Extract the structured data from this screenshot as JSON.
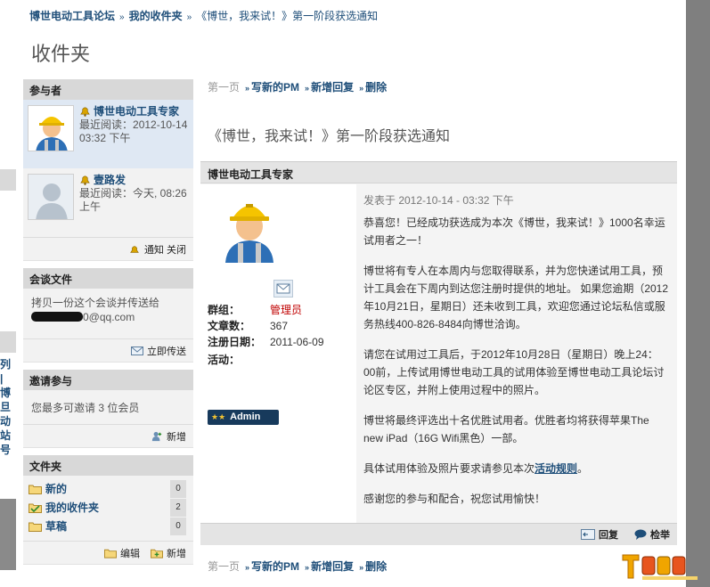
{
  "breadcrumb": {
    "forum": "博世电动工具论坛",
    "inbox": "我的收件夹",
    "current": "《博世，我来试！》第一阶段获选通知",
    "sep": "»"
  },
  "page_title": "收件夹",
  "sidebar": {
    "participants": {
      "header": "参与者",
      "items": [
        {
          "name": "博世电动工具专家",
          "last_read_label": "最近阅读：",
          "last_read": "2012-10-14 03:32 下午"
        },
        {
          "name": "壹路发",
          "last_read_label": "最近阅读：",
          "last_read": "今天, 08:26 上午"
        }
      ],
      "footer_action": "通知 关闭"
    },
    "conversation": {
      "header": "会谈文件",
      "text": "拷贝一份这个会谈并传送给",
      "email_suffix": "0@qq.com",
      "footer_action": "立即传送"
    },
    "invite": {
      "header": "邀请参与",
      "text": "您最多可邀请 3 位会员",
      "footer_action": "新增"
    },
    "folders": {
      "header": "文件夹",
      "items": [
        {
          "label": "新的",
          "count": "0"
        },
        {
          "label": "我的收件夹",
          "count": "2"
        },
        {
          "label": "草稿",
          "count": "0"
        }
      ],
      "edit": "编辑",
      "add": "新增"
    }
  },
  "toolbar": {
    "first": "第一页",
    "arrow": "»",
    "new_pm": "写新的PM",
    "reply": "新增回复",
    "delete": "删除"
  },
  "message": {
    "subject": "《博世，我来试！》第一阶段获选通知",
    "author": "博世电动工具专家",
    "group_label": "群组：",
    "group_value": "管理员",
    "posts_label": "文章数：",
    "posts_value": "367",
    "reg_label": "注册日期：",
    "reg_value": "2011-06-09",
    "activity_label": "活动：",
    "badge": "Admin",
    "posted": "发表于 2012-10-14 - 03:32 下午",
    "paragraphs": [
      "恭喜您！已经成功获选成为本次《博世，我来试！》1000名幸运试用者之一！",
      "博世将有专人在本周内与您取得联系，并为您快递试用工具，预计工具会在下周内到达您注册时提供的地址。 如果您逾期（2012年10月21日，星期日）还未收到工具，欢迎您通过论坛私信或服务热线400-826-8484向博世洽询。",
      "请您在试用过工具后，于2012年10月28日（星期日）晚上24：00前，上传试用博世电动工具的试用体验至博世电动工具论坛讨论区专区，并附上使用过程中的照片。",
      "博世将最终评选出十名优胜试用者。优胜者均将获得苹果The new iPad（16G Wifi黑色）一部。"
    ],
    "rules_prefix": "具体试用体验及照片要求请参见本次",
    "rules_link": "活动规则",
    "rules_suffix": "。",
    "closing": "感谢您的参与和配合，祝您试用愉快！",
    "reply_button": "回复",
    "report_button": "检举"
  },
  "left_edge_chars": [
    "列",
    "|",
    "博",
    "旦",
    "动",
    "站",
    "号"
  ],
  "colors": {
    "link": "#1e4e79",
    "admin_badge": "#173a5c",
    "group_red": "#c00000",
    "right_band": "#7f7f7f"
  }
}
